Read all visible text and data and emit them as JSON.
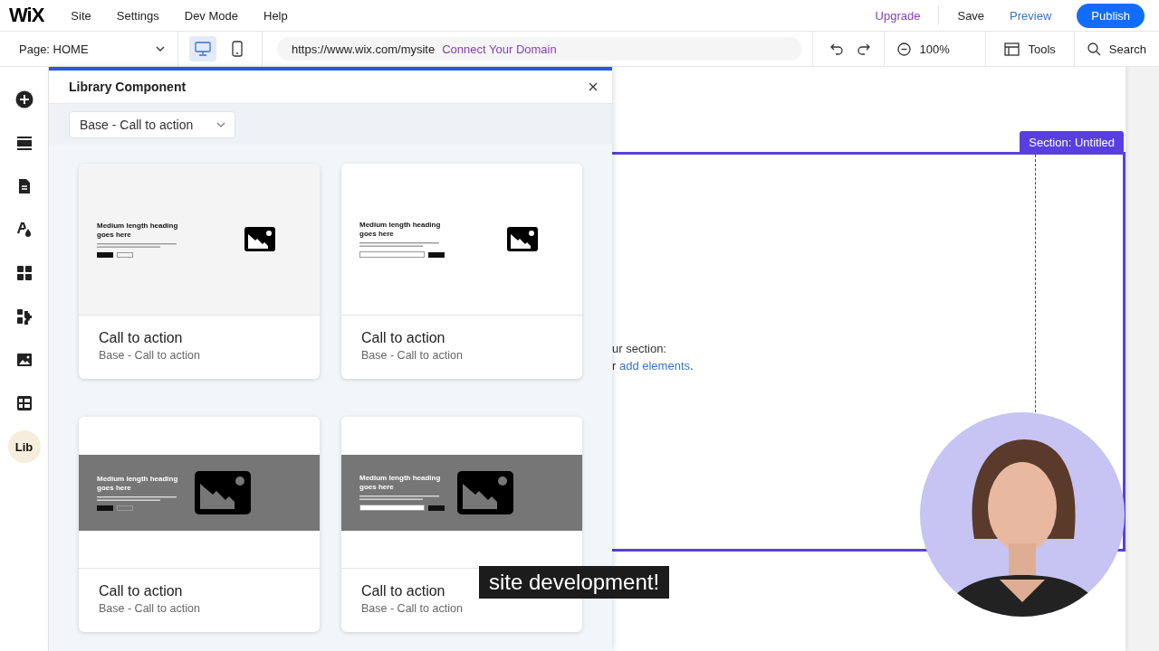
{
  "top_bar": {
    "logo": "WiX",
    "menu": [
      "Site",
      "Settings",
      "Dev Mode",
      "Help"
    ],
    "upgrade": "Upgrade",
    "save": "Save",
    "preview": "Preview",
    "publish": "Publish"
  },
  "toolbar": {
    "page_selector": "Page: HOME",
    "devices": [
      {
        "kind": "desktop",
        "selected": true
      },
      {
        "kind": "mobile",
        "selected": false
      }
    ],
    "url": "https://www.wix.com/mysite",
    "connect_domain": "Connect Your Domain",
    "zoom": "100%",
    "tools": "Tools",
    "search": "Search"
  },
  "rail": [
    {
      "kind": "add",
      "selected": false
    },
    {
      "kind": "sections",
      "selected": false
    },
    {
      "kind": "pages",
      "selected": false
    },
    {
      "kind": "design",
      "selected": false
    },
    {
      "kind": "apps",
      "selected": false
    },
    {
      "kind": "market",
      "selected": false
    },
    {
      "kind": "media",
      "selected": false
    },
    {
      "kind": "cms",
      "selected": false
    },
    {
      "kind": "lib",
      "label": "Lib",
      "selected": true
    }
  ],
  "panel": {
    "title": "Library Component",
    "filter": "Base - Call to action",
    "cards": [
      {
        "kind": "buttons",
        "heading": "Medium length heading goes here",
        "title": "Call to action",
        "subtitle": "Base - Call to action"
      },
      {
        "kind": "email",
        "heading": "Medium length heading goes here",
        "title": "Call to action",
        "subtitle": "Base - Call to action"
      },
      {
        "kind": "buttons",
        "heading": "Medium length heading goes here",
        "title": "Call to action",
        "subtitle": "Base - Call to action"
      },
      {
        "kind": "email",
        "heading": "Medium length heading goes here",
        "title": "Call to action",
        "subtitle": "Base - Call to action"
      }
    ]
  },
  "canvas": {
    "section_label": "Section: Untitled",
    "hint_line_1": "ur section:",
    "hint_before": "r ",
    "hint_link": "add elements",
    "hint_after": "."
  },
  "video": {
    "caption": "site development!"
  }
}
